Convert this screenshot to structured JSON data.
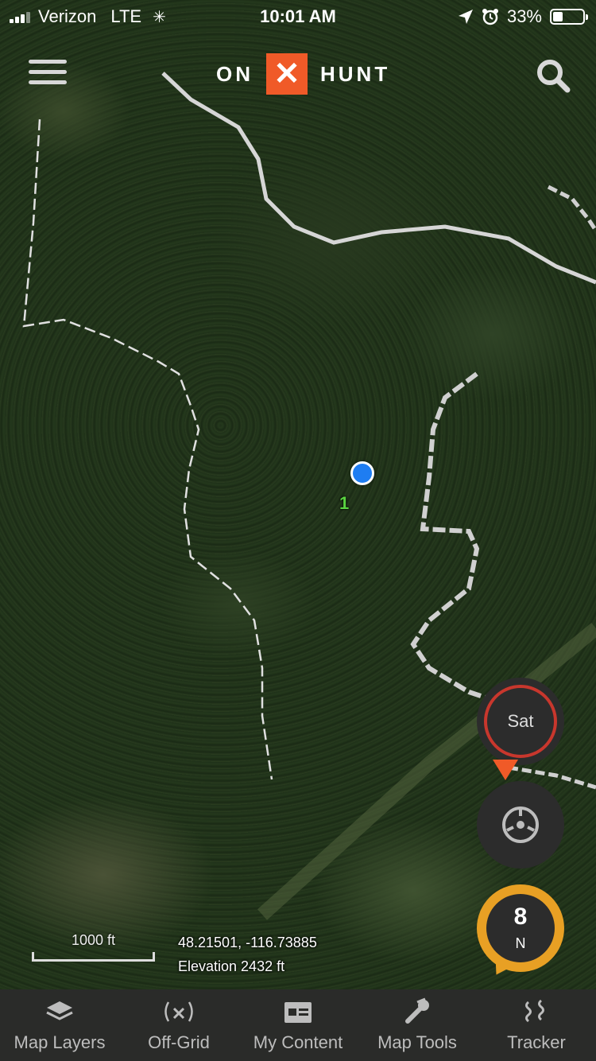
{
  "status_bar": {
    "carrier": "Verizon",
    "network": "LTE",
    "time": "10:01 AM",
    "battery": "33%",
    "battery_level": 0.33
  },
  "header": {
    "logo_left": "ON",
    "logo_mark": "✕",
    "logo_right": "HUNT",
    "menu_icon": "hamburger-icon",
    "search_icon": "search-icon"
  },
  "map": {
    "waypoint_label": "1",
    "scale_label": "1000 ft",
    "coordinates": "48.21501, -116.73885",
    "elevation": "Elevation 2432 ft",
    "layer_button_label": "Sat",
    "compass_number": "8",
    "compass_direction": "N",
    "colors": {
      "accent": "#f05a28",
      "compass": "#e8a024",
      "location_dot": "#1e7df2"
    }
  },
  "tabs": [
    {
      "label": "Map Layers",
      "icon": "layers-icon"
    },
    {
      "label": "Off-Grid",
      "icon": "signal-icon"
    },
    {
      "label": "My Content",
      "icon": "folder-icon"
    },
    {
      "label": "Map Tools",
      "icon": "tools-icon"
    },
    {
      "label": "Tracker",
      "icon": "tracker-icon"
    }
  ]
}
